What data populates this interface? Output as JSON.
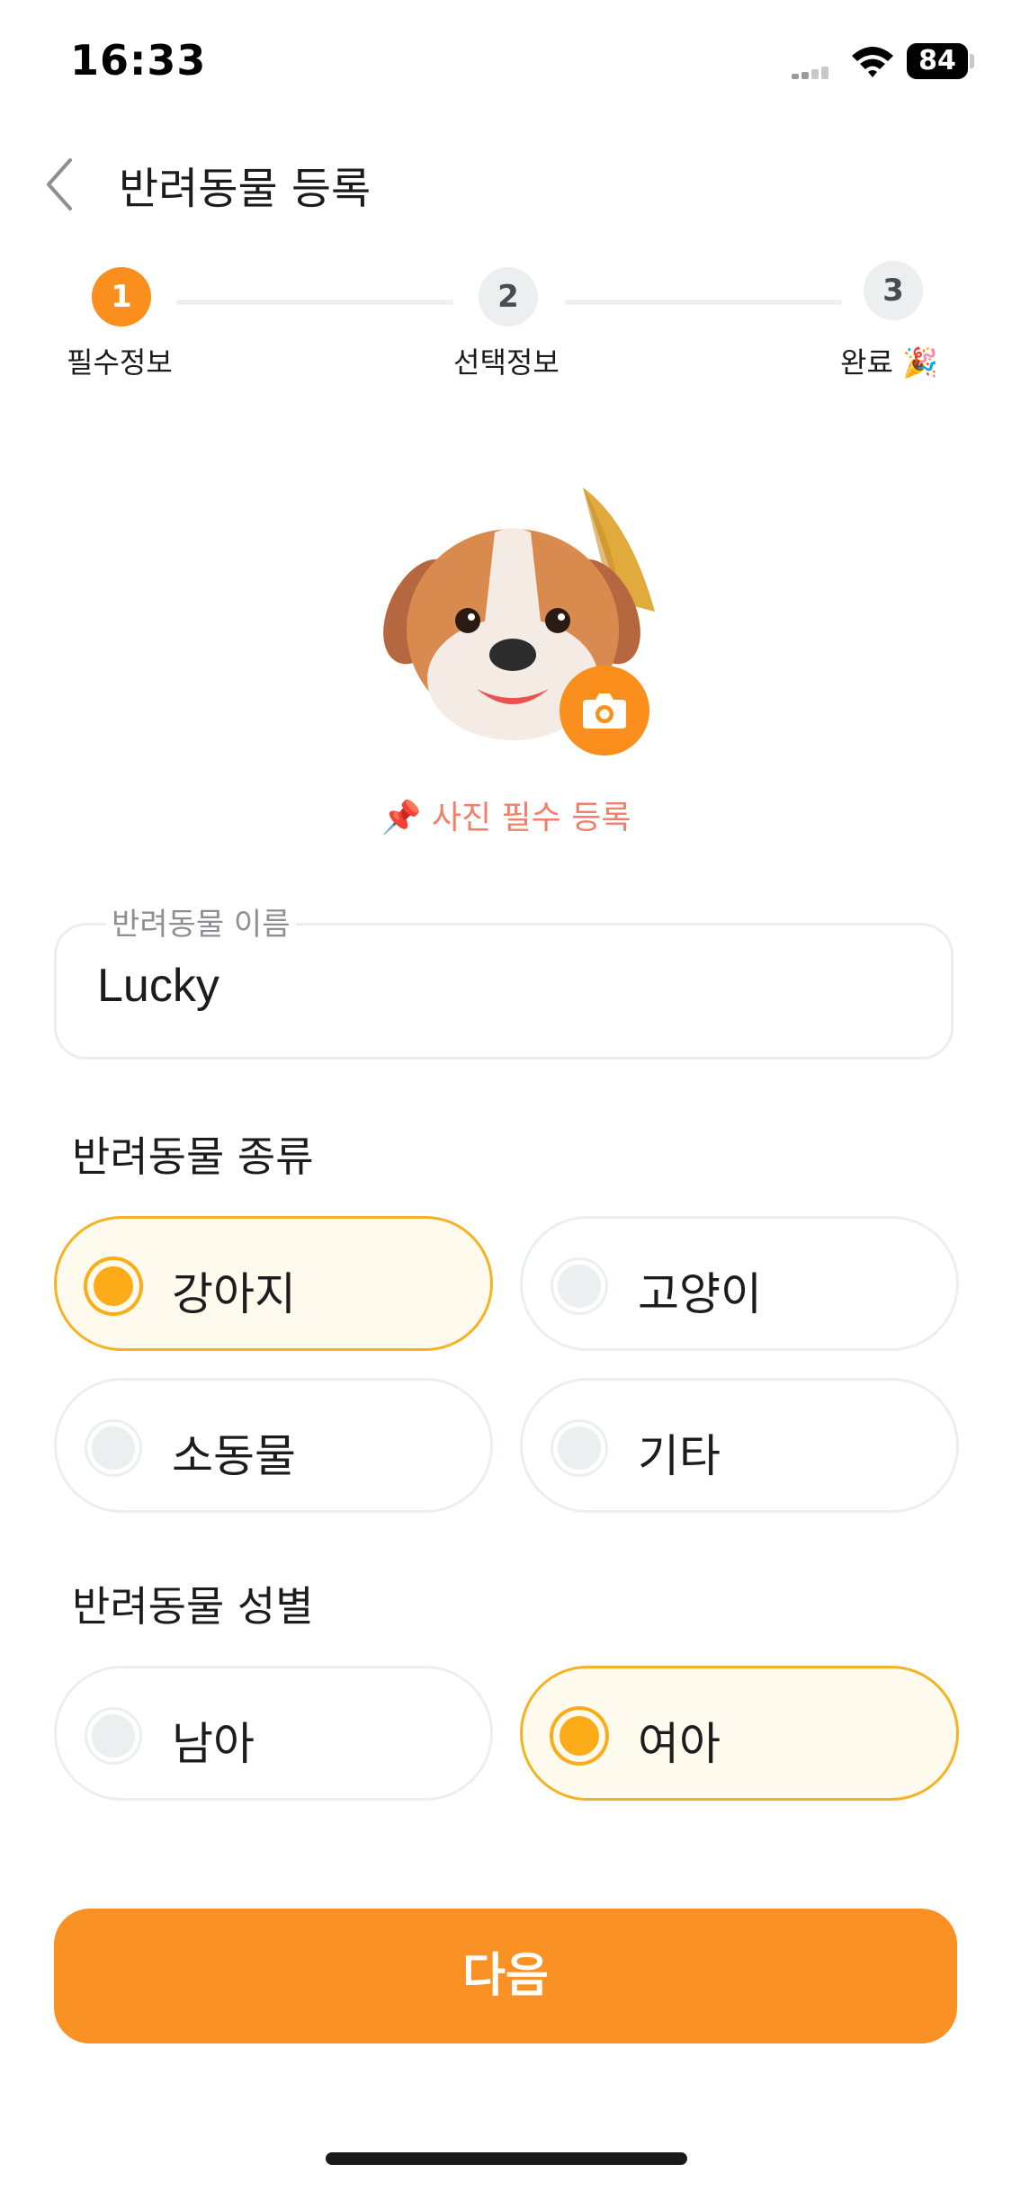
{
  "status_bar": {
    "time": "16:33",
    "battery": "84"
  },
  "header": {
    "title": "반려동물 등록"
  },
  "stepper": {
    "steps": [
      {
        "number": "1",
        "label": "필수정보",
        "state": "active"
      },
      {
        "number": "2",
        "label": "선택정보",
        "state": "inactive"
      },
      {
        "number": "3",
        "label": "완료 🎉",
        "state": "inactive"
      }
    ]
  },
  "photo": {
    "hint": "📌 사진 필수 등록",
    "avatar": "dog-emoji-avatar",
    "button_icon": "camera-icon"
  },
  "name_field": {
    "label": "반려동물 이름",
    "value": "Lucky"
  },
  "species": {
    "title": "반려동물 종류",
    "options": [
      {
        "label": "강아지",
        "selected": true
      },
      {
        "label": "고양이",
        "selected": false
      },
      {
        "label": "소동물",
        "selected": false
      },
      {
        "label": "기타",
        "selected": false
      }
    ]
  },
  "gender": {
    "title": "반려동물 성별",
    "options": [
      {
        "label": "남아",
        "selected": false
      },
      {
        "label": "여아",
        "selected": true
      }
    ]
  },
  "next_button": {
    "label": "다음"
  },
  "colors": {
    "accent": "#fa8f1e",
    "selected_border": "#f5b324",
    "selected_bg": "#fffaee",
    "hint": "#f27f6a"
  }
}
